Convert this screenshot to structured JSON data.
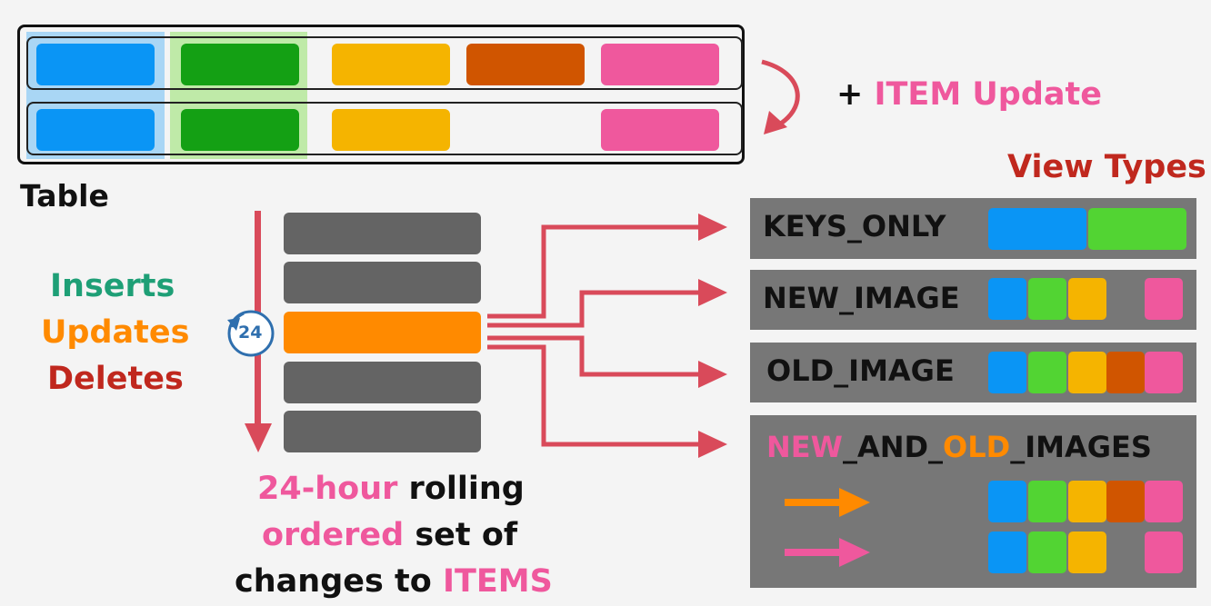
{
  "title_update": {
    "plus": "+ ",
    "item": "ITEM",
    "update": " Update"
  },
  "table_label": "Table",
  "ops": {
    "inserts": "Inserts",
    "updates": "Updates",
    "deletes": "Deletes"
  },
  "clock_badge": "24",
  "caption": {
    "line1_a": "24-hour",
    "line1_b": " rolling",
    "line2_a": "ordered",
    "line2_b": " set of",
    "line3_a": "changes to ",
    "line3_b": "ITEMS"
  },
  "view_types_heading": "View Types",
  "view_types": {
    "keys_only": "KEYS_ONLY",
    "new_image": "NEW_IMAGE",
    "old_image": "OLD_IMAGE",
    "new_and_old": {
      "new": "NEW",
      "sep1": "_AND_",
      "old": "OLD",
      "sep2": "_IMAGES"
    }
  },
  "colors": {
    "blue": "#0a95f5",
    "green": "#14a014",
    "lightgreen": "#52d433",
    "yellow": "#f5b400",
    "rust": "#d05500",
    "pink": "#ef589d",
    "orange": "#ff8a00",
    "gray": "#646464",
    "red": "#d94a5a",
    "teal": "#1e9f76",
    "darkred": "#c0281e"
  }
}
